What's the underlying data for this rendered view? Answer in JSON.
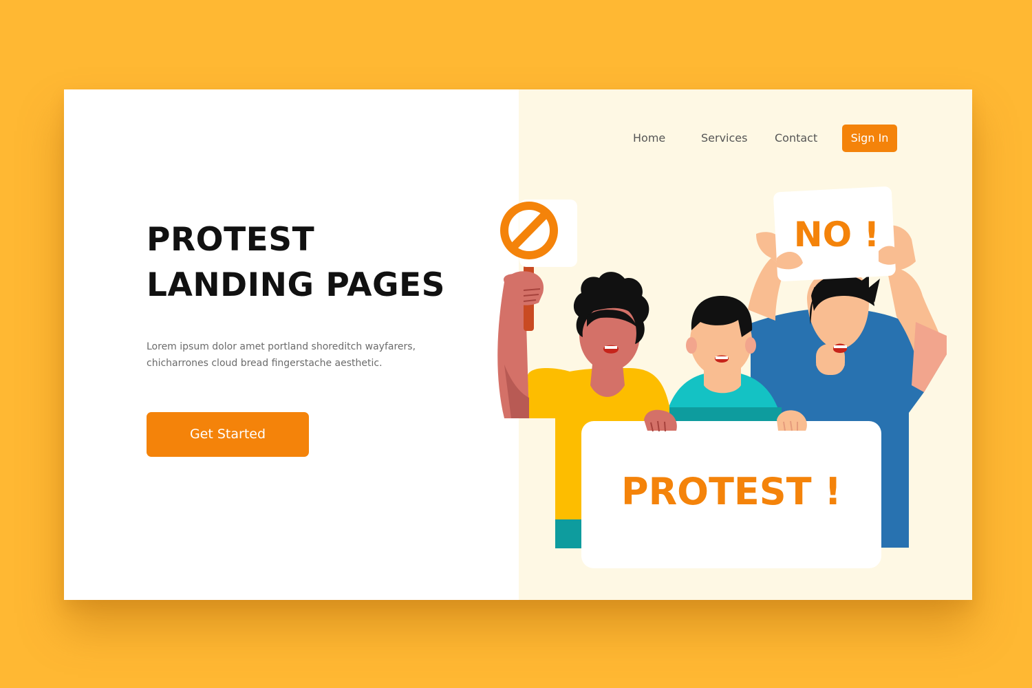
{
  "hero": {
    "title_line1": "PROTEST",
    "title_line2": "LANDING PAGES",
    "description": "Lorem ipsum dolor amet portland shoreditch wayfarers, chicharrones cloud bread fingerstache aesthetic.",
    "cta_label": "Get Started"
  },
  "nav": {
    "items": [
      {
        "label": "Home"
      },
      {
        "label": "Services"
      },
      {
        "label": "Contact"
      }
    ],
    "signin_label": "Sign In"
  },
  "illustration": {
    "sign_no": "NO !",
    "banner": "PROTEST !",
    "prohibited_icon": "prohibited-icon"
  },
  "colors": {
    "page_background": "#FFB833",
    "accent": "#F4830A",
    "panel_background": "#FEF8E4",
    "heading": "#111111",
    "body_text": "#6b6b6b"
  }
}
